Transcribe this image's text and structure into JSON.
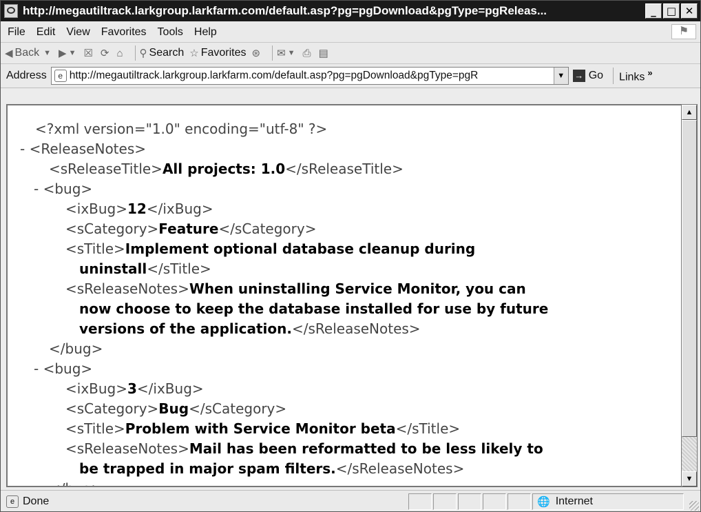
{
  "window": {
    "title": "http://megautiltrack.larkgroup.larkfarm.com/default.asp?pg=pgDownload&pgType=pgReleas...",
    "minimize": "_",
    "maximize": "□",
    "close": "✕"
  },
  "menu": [
    "File",
    "Edit",
    "View",
    "Favorites",
    "Tools",
    "Help"
  ],
  "toolbar": {
    "back": "Back",
    "search": "Search",
    "favorites": "Favorites"
  },
  "address": {
    "label": "Address",
    "url": "http://megautiltrack.larkgroup.larkfarm.com/default.asp?pg=pgDownload&pgType=pgR",
    "go": "Go",
    "links": "Links"
  },
  "xml": {
    "declaration": "<?xml version=\"1.0\" encoding=\"utf-8\" ?>",
    "root_open": "<ReleaseNotes>",
    "release_title": {
      "open": "<sReleaseTitle>",
      "value": "All projects: 1.0",
      "close": "</sReleaseTitle>"
    },
    "bugs": [
      {
        "open": "<bug>",
        "ixBug_open": "<ixBug>",
        "ixBug": "12",
        "ixBug_close": "</ixBug>",
        "cat_open": "<sCategory>",
        "category": "Feature",
        "cat_close": "</sCategory>",
        "title_open": "<sTitle>",
        "title_line1": "Implement optional database cleanup during",
        "title_line2": "uninstall",
        "title_close": "</sTitle>",
        "notes_open": "<sReleaseNotes>",
        "notes_line1": "When uninstalling Service Monitor, you can",
        "notes_line2": "now choose to keep the database installed for use by future",
        "notes_line3": "versions of the application.",
        "notes_close": "</sReleaseNotes>",
        "close": "</bug>"
      },
      {
        "open": "<bug>",
        "ixBug_open": "<ixBug>",
        "ixBug": "3",
        "ixBug_close": "</ixBug>",
        "cat_open": "<sCategory>",
        "category": "Bug",
        "cat_close": "</sCategory>",
        "title_open": "<sTitle>",
        "title_line1": "Problem with Service Monitor beta",
        "title_close": "</sTitle>",
        "notes_open": "<sReleaseNotes>",
        "notes_line1": "Mail has been reformatted to be less likely to",
        "notes_line2": "be trapped in major spam filters.",
        "notes_close": "</sReleaseNotes>",
        "close": "</bug>"
      }
    ],
    "collapse_marker": "-"
  },
  "status": {
    "text": "Done",
    "zone": "Internet"
  }
}
